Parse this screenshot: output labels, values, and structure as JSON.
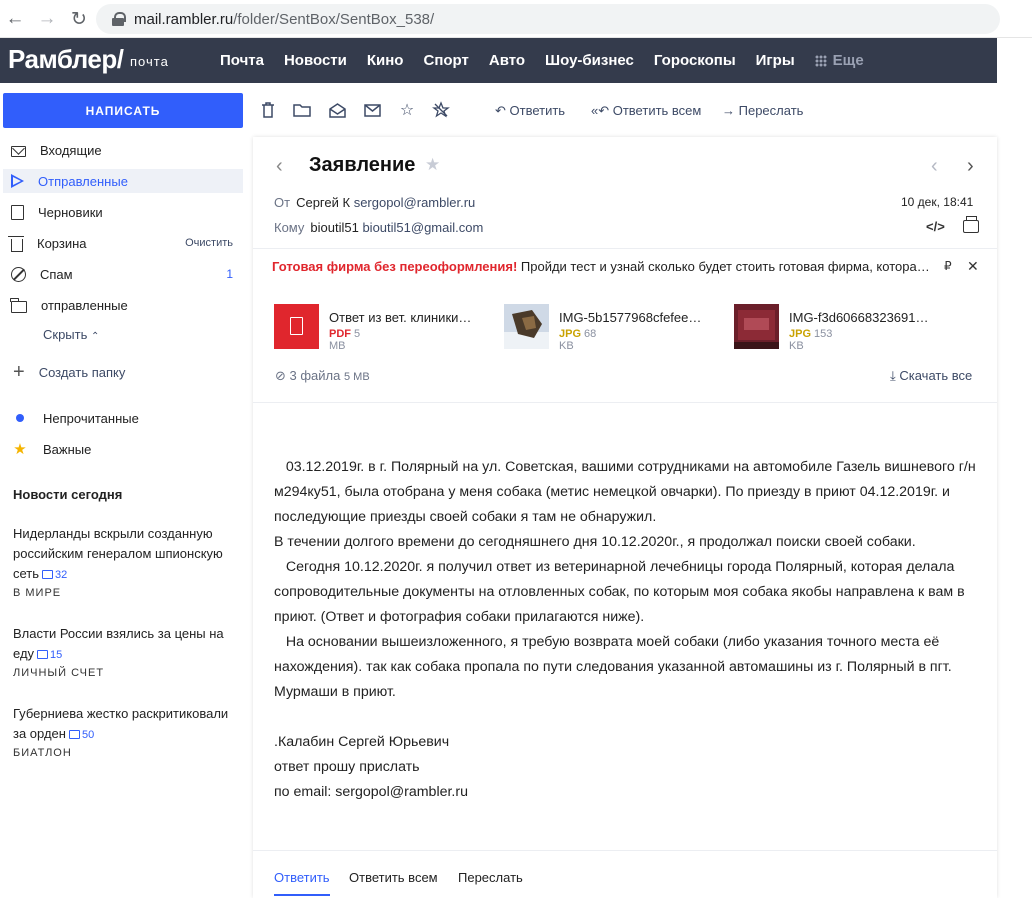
{
  "browser": {
    "url_host": "mail.rambler.ru",
    "url_path": "/folder/SentBox/SentBox_538/"
  },
  "topnav": {
    "logo": "Рамблер/",
    "logo_sub": "почта",
    "links": [
      "Почта",
      "Новости",
      "Кино",
      "Спорт",
      "Авто",
      "Шоу-бизнес",
      "Гороскопы",
      "Игры"
    ],
    "more": "Еще"
  },
  "sidebar": {
    "compose": "НАПИСАТЬ",
    "folders": [
      {
        "label": "Входящие",
        "icon": "inbox-icon",
        "count": "",
        "action": ""
      },
      {
        "label": "Отправленные",
        "icon": "send-icon",
        "count": "",
        "action": ""
      },
      {
        "label": "Черновики",
        "icon": "draft-icon",
        "count": "",
        "action": ""
      },
      {
        "label": "Корзина",
        "icon": "trash-icon",
        "count": "",
        "action": "Очистить"
      },
      {
        "label": "Спам",
        "icon": "spam-icon",
        "count": "1",
        "action": ""
      },
      {
        "label": "отправленные",
        "icon": "folder-icon",
        "count": "",
        "action": ""
      }
    ],
    "hide": "Скрыть",
    "create_folder": "Создать папку",
    "unread": "Непрочитанные",
    "important": "Важные",
    "news_title": "Новости сегодня",
    "news": [
      {
        "text": "Нидерланды вскрыли созданную российским генералом шпионскую сеть",
        "comments": "32",
        "category": "В МИРЕ"
      },
      {
        "text": "Власти России взялись за цены на еду",
        "comments": "15",
        "category": "ЛИЧНЫЙ СЧЕТ"
      },
      {
        "text": "Губерниева жестко раскритиковали за орден",
        "comments": "50",
        "category": "БИАТЛОН"
      }
    ]
  },
  "toolbar": {
    "reply": "Ответить",
    "reply_all": "Ответить всем",
    "forward": "Переслать"
  },
  "message": {
    "subject": "Заявление",
    "from_label": "От",
    "from_name": "Сергей К",
    "from_email": "sergopol@rambler.ru",
    "to_label": "Кому",
    "to_name": "bioutil51",
    "to_email": "bioutil51@gmail.com",
    "date": "10 дек, 18:41",
    "promo_bold": "Готовая фирма без переоформления!",
    "promo_text": " Пройди тест и узнай сколько будет стоить готовая фирма, котора…",
    "attachments": [
      {
        "name": "Ответ из вет. клиники…",
        "ext": "PDF",
        "size": "5 MB",
        "ext_color": "#e0262d"
      },
      {
        "name": "IMG-5b1577968cfefee…",
        "ext": "JPG",
        "size": "68 KB",
        "ext_color": "#c9a200"
      },
      {
        "name": "IMG-f3d60668323691…",
        "ext": "JPG",
        "size": "153 KB",
        "ext_color": "#c9a200"
      }
    ],
    "files_count": "3 файла",
    "files_size": "5 MB",
    "download_all": "Скачать все",
    "body": [
      "   03.12.2019г. в г. Полярный на ул. Советская, вашими сотрудниками на автомобиле Газель вишневого г/н м294ку51, была отобрана у меня собака (метис немецкой овчарки). По приезду в приют 04.12.2019г. и последующие приезды своей собаки я там не обнаружил.",
      "В течении долгого времени до сегодняшнего дня 10.12.2020г., я продолжал поиски своей собаки.",
      "   Сегодня 10.12.2020г. я получил ответ из ветеринарной лечебницы города Полярный, которая делала сопроводительные документы на отловленных собак, по которым моя собака якобы направлена к вам в приют. (Ответ и фотография собаки прилагаются ниже).",
      "   На основании вышеизложенного, я требую возврата моей собаки (либо указания точного места её нахождения). так как собака пропала по пути следования указанной автомашины из г. Полярный в пгт. Мурмаши в приют.",
      "",
      ".Калабин Сергей Юрьевич",
      "ответ прошу прислать",
      "по email: sergopol@rambler.ru"
    ],
    "footer": {
      "reply": "Ответить",
      "reply_all": "Ответить всем",
      "forward": "Переслать"
    }
  }
}
